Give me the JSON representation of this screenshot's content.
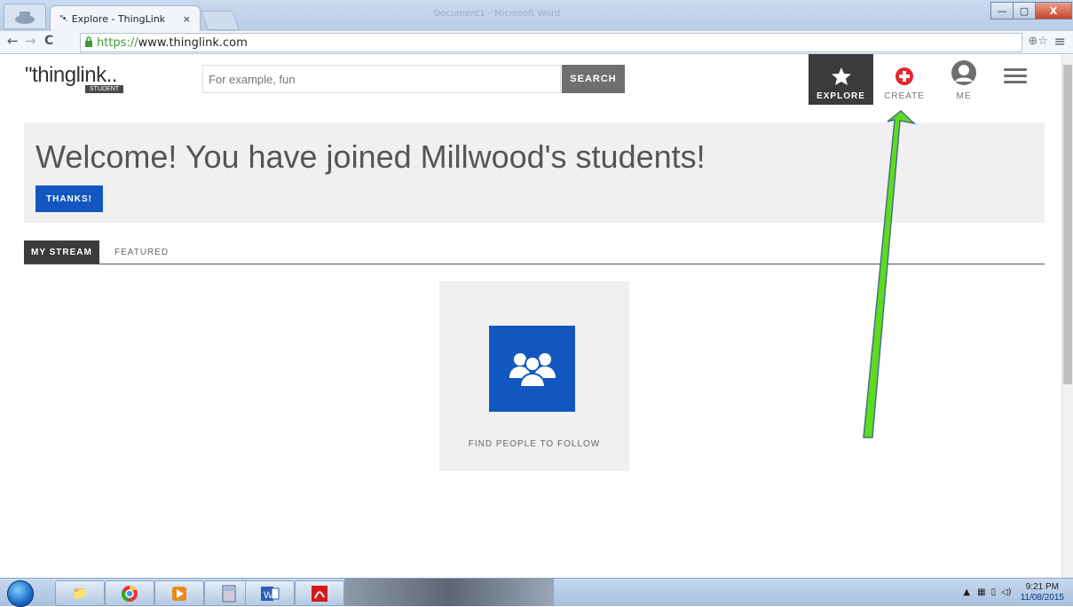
{
  "browser": {
    "tab_title": "Explore - ThingLink",
    "tab_close": "×",
    "favicon": "\"•.",
    "bg_window_title": "Document1 - Microsoft Word",
    "url_scheme": "https://",
    "url_host": "www.thinglink.com",
    "back": "←",
    "forward": "→",
    "reload": "C",
    "minimize": "—",
    "restore": "▢",
    "close": "X"
  },
  "header": {
    "logo_text": "\"thinglink..",
    "logo_badge": "STUDENT",
    "search_placeholder": "For example, fun",
    "search_button": "SEARCH",
    "nav": {
      "explore": "EXPLORE",
      "create": "CREATE",
      "me": "ME"
    }
  },
  "welcome": {
    "title": "Welcome! You have joined Millwood's students!",
    "thanks_button": "THANKS!"
  },
  "tabs": {
    "my_stream": "MY STREAM",
    "featured": "FEATURED"
  },
  "follow_card": {
    "label": "FIND PEOPLE TO FOLLOW",
    "icon": "people-group-icon"
  },
  "annotation": {
    "arrow_color": "#5cdc1c",
    "arrow_outline": "#4a6f8f"
  },
  "taskbar": {
    "time": "9:21 PM",
    "date": "11/08/2015",
    "apps": [
      "explorer-icon",
      "chrome-icon",
      "media-player-icon",
      "calculator-icon",
      "word-icon",
      "acrobat-icon"
    ]
  },
  "colors": {
    "accent_blue": "#1257c0",
    "dark_nav": "#3a3b3d",
    "create_red": "#e3262d"
  }
}
